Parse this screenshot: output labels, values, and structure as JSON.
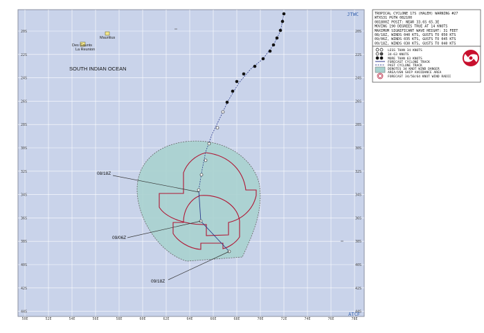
{
  "map": {
    "agency_top": "JTWC",
    "agency_bottom": "ATCF",
    "region_label": "SOUTH INDIAN OCEAN",
    "lat_labels": [
      "20S",
      "22S",
      "24S",
      "26S",
      "28S",
      "30S",
      "32S",
      "34S",
      "36S",
      "38S",
      "40S",
      "42S",
      "44S"
    ],
    "lon_labels": [
      "50E",
      "52E",
      "54E",
      "56E",
      "58E",
      "60E",
      "62E",
      "64E",
      "66E",
      "68E",
      "70E",
      "72E",
      "74E",
      "76E",
      "78E"
    ],
    "places": {
      "mauritius": "Mauritius",
      "reunion": "La Reunion",
      "desgaunts": "Des Gaunts"
    },
    "time_labels": {
      "t1": "08/18Z",
      "t2": "09/06Z",
      "t3": "09/18Z"
    },
    "colors": {
      "ocean": "#c9d3ea",
      "land": "#f4e68a",
      "danger_fill": "#a9d2cf",
      "radii": "#b01432",
      "track": "#2b3a8c",
      "grid": "#ffffff"
    }
  },
  "info": {
    "lines": [
      "TROPICAL CYCLONE 17S (HALEH) WARNING #27",
      "WTXS31 PGTW 082100",
      "081800Z POSIT: NEAR 33.6S 65.3E",
      "MOVING 190 DEGREES TRUE AT 14 KNOTS",
      "MAXIMUM SIGNIFICANT WAVE HEIGHT: 31 FEET",
      "08/18Z, WINDS 040 KTS, GUSTS TO 050 KTS",
      "09/06Z, WINDS 035 KTS, GUSTS TO 045 KTS",
      "09/18Z, WINDS 030 KTS, GUSTS TO 040 KTS"
    ]
  },
  "legend": {
    "items": [
      "LESS THAN 34 KNOTS",
      "34-63 KNOTS",
      "MORE THAN 63 KNOTS",
      "FORECAST CYCLONE TRACK",
      "PAST CYCLONE TRACK",
      "DENOTES 34 KNOT WIND DANGER",
      "AREA/USN SHIP AVOIDANCE AREA",
      "FORECAST 34/50/64 KNOT WIND RADII"
    ]
  }
}
